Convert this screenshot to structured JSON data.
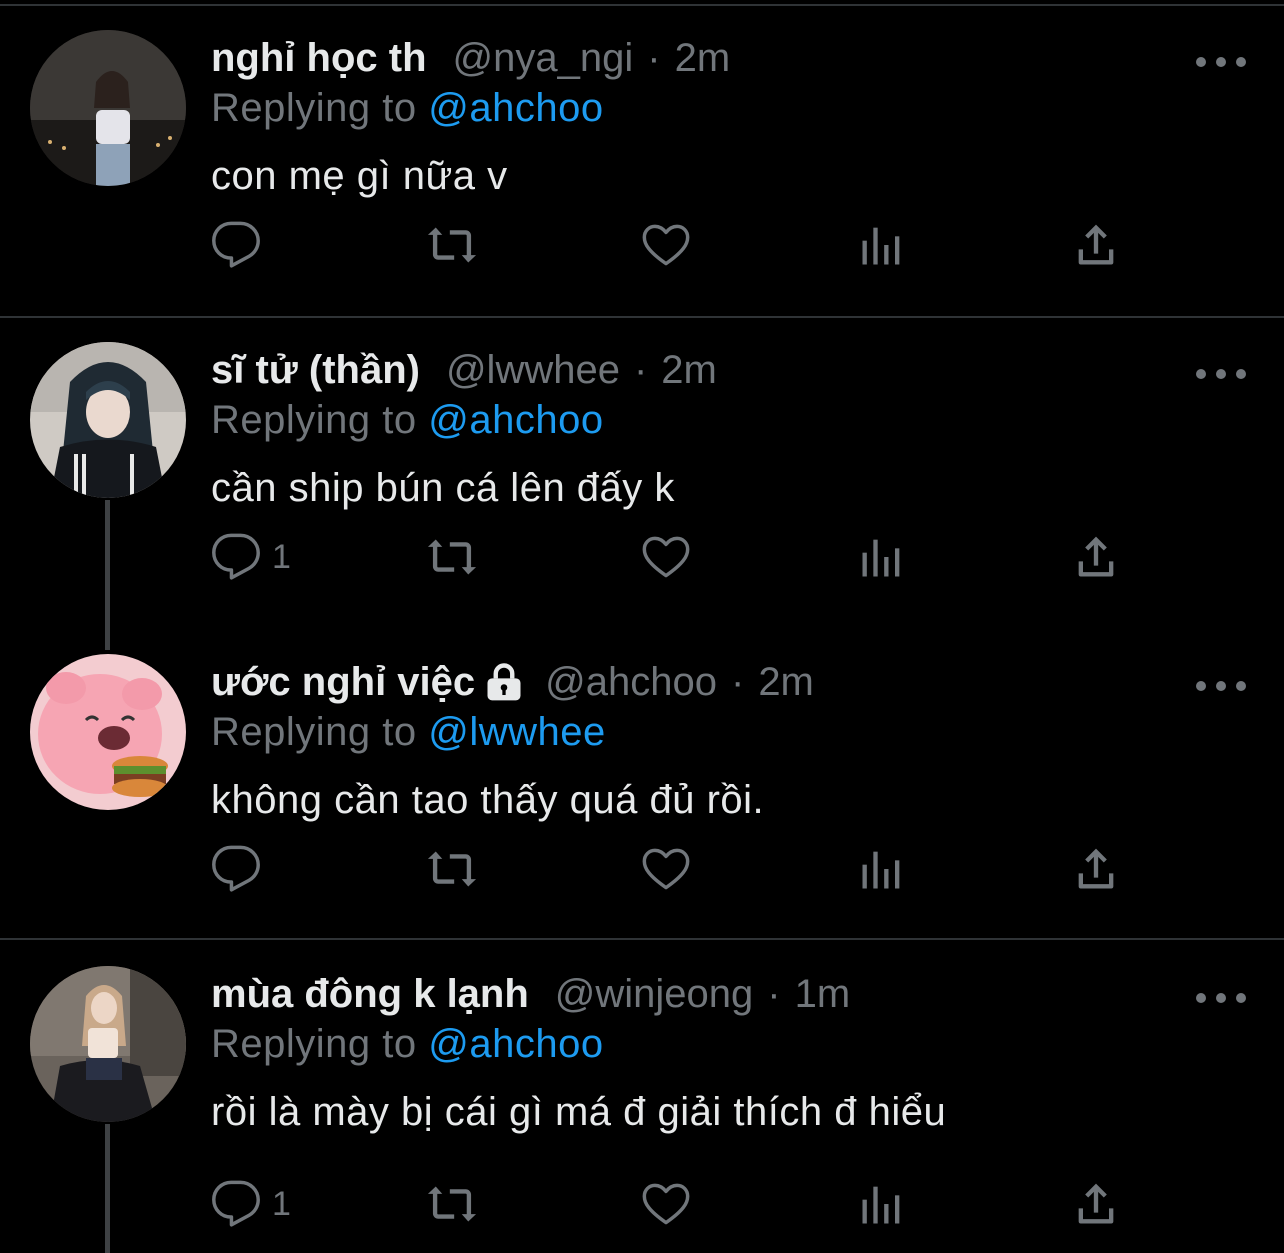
{
  "colors": {
    "background": "#000000",
    "text_primary": "#e7e9ea",
    "text_secondary": "#71767b",
    "accent": "#1d9bf0",
    "divider": "#2f3336"
  },
  "action_icons": [
    "reply-icon",
    "retweet-icon",
    "like-icon",
    "analytics-icon",
    "share-icon"
  ],
  "tweets": [
    {
      "display_name": "nghỉ học th",
      "protected": false,
      "handle": "@nya_ngi",
      "separator": "·",
      "time": "2m",
      "replying_prefix": "Replying to",
      "replying_to": "@ahchoo",
      "text": "con mẹ gì nữa v",
      "reply_count": ""
    },
    {
      "display_name": "sĩ tử (thần)",
      "protected": false,
      "handle": "@lwwhee",
      "separator": "·",
      "time": "2m",
      "replying_prefix": "Replying to",
      "replying_to": "@ahchoo",
      "text": "cần ship bún cá lên đấy k",
      "reply_count": "1"
    },
    {
      "display_name": "ước nghỉ việc",
      "protected": true,
      "handle": "@ahchoo",
      "separator": "·",
      "time": "2m",
      "replying_prefix": "Replying to",
      "replying_to": "@lwwhee",
      "text": "không cần tao thấy quá đủ rồi.",
      "reply_count": ""
    },
    {
      "display_name": "mùa đông k lạnh",
      "protected": false,
      "handle": "@winjeong",
      "separator": "·",
      "time": "1m",
      "replying_prefix": "Replying to",
      "replying_to": "@ahchoo",
      "text": "rồi là mày bị cái gì má đ giải thích đ hiểu",
      "reply_count": "1"
    }
  ]
}
